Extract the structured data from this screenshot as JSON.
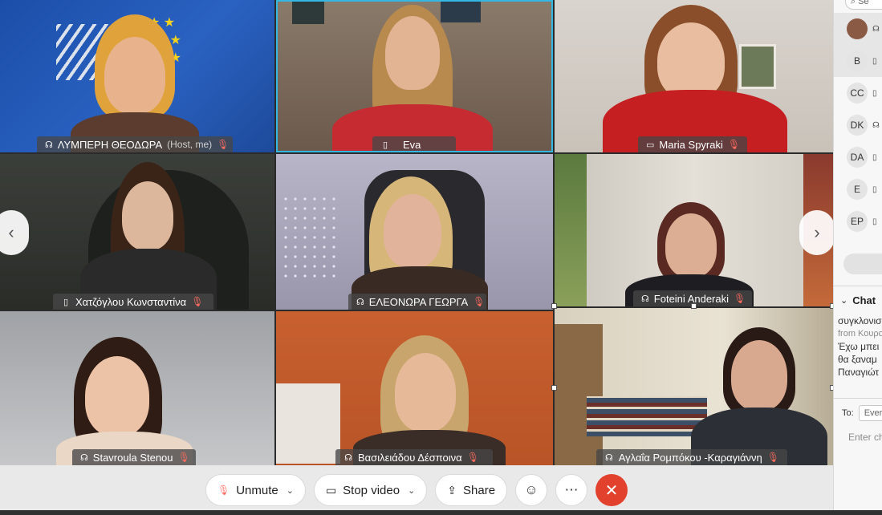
{
  "participants_grid": [
    {
      "name": "ΛΥΜΠΕΡΗ ΘΕΟΔΩΡΑ",
      "tag": "(Host, me)",
      "device": "audio",
      "muted": true,
      "active": false
    },
    {
      "name": "Eva",
      "tag": "",
      "device": "mobile",
      "muted": false,
      "active": true
    },
    {
      "name": "Maria Spyraki",
      "tag": "",
      "device": "desktop",
      "muted": true,
      "active": false
    },
    {
      "name": "Χατζόγλου Κωνσταντίνα",
      "tag": "",
      "device": "mobile",
      "muted": true,
      "active": false
    },
    {
      "name": "ΕΛΕΟΝΩΡΑ ΓΕΩΡΓΑ",
      "tag": "",
      "device": "audio",
      "muted": true,
      "active": false
    },
    {
      "name": "Foteini Anderaki",
      "tag": "",
      "device": "audio",
      "muted": true,
      "active": false
    },
    {
      "name": "Stavroula Stenou",
      "tag": "",
      "device": "audio",
      "muted": true,
      "active": false
    },
    {
      "name": "Βασιλειάδου Δέσποινα",
      "tag": "",
      "device": "audio",
      "muted": true,
      "active": false
    },
    {
      "name": "Αγλαΐα Ρομπόκου -Καραγιάννη",
      "tag": "",
      "device": "audio",
      "muted": true,
      "active": false
    }
  ],
  "controls": {
    "unmute": "Unmute",
    "stop_video": "Stop video",
    "share": "Share",
    "reactions_icon": "smiley-icon",
    "more_icon": "ellipsis-icon",
    "end_icon": "close-icon"
  },
  "panel": {
    "search_placeholder": "Se",
    "participants": [
      {
        "initials": "",
        "photo": true
      },
      {
        "initials": "B"
      },
      {
        "initials": "CC"
      },
      {
        "initials": "DK"
      },
      {
        "initials": "DA"
      },
      {
        "initials": "E"
      },
      {
        "initials": "EP"
      }
    ],
    "chat_title": "Chat",
    "chat_lines": [
      "συγκλονισ",
      "from Κουρο",
      "Έχω μπει",
      "θα ξαναμ",
      "Παναγιώτ"
    ],
    "to_label": "To:",
    "to_value": "Ever",
    "input_placeholder": "Enter ch"
  },
  "colors": {
    "active_border": "#35b7e4",
    "end_call": "#e2412d",
    "muted_icon": "#ff6b5e"
  }
}
